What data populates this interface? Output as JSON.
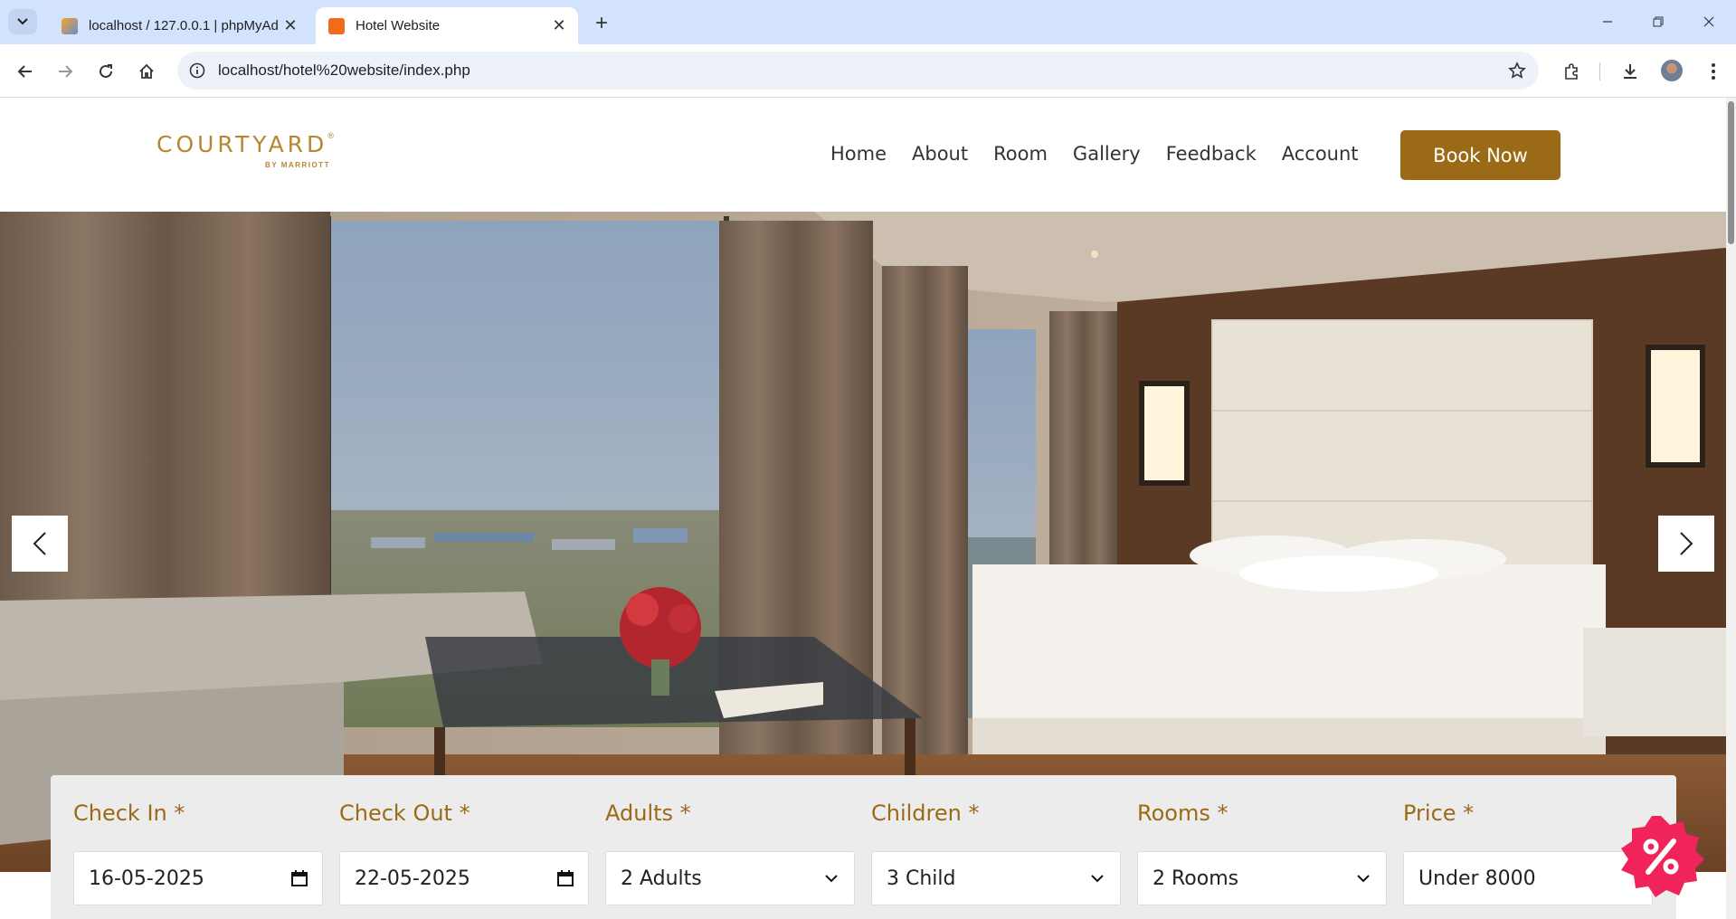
{
  "browser": {
    "tabs": [
      {
        "title": "localhost / 127.0.0.1 | phpMyAd",
        "favicon": "phpmyadmin-icon",
        "active": false
      },
      {
        "title": "Hotel Website",
        "favicon": "xampp-icon",
        "active": true
      }
    ],
    "url": "localhost/hotel%20website/index.php"
  },
  "site": {
    "logo": {
      "main": "COURTYARD",
      "sub": "BY MARRIOTT",
      "mark": "®"
    },
    "nav": [
      "Home",
      "About",
      "Room",
      "Gallery",
      "Feedback",
      "Account"
    ],
    "cta": "Book Now",
    "brand_color": "#9b6a16"
  },
  "hero": {
    "prev_icon": "chevron-left-icon",
    "next_icon": "chevron-right-icon"
  },
  "booking": {
    "fields": [
      {
        "label": "Check In *",
        "value": "16-05-2025",
        "kind": "date",
        "icon": "calendar-icon"
      },
      {
        "label": "Check Out *",
        "value": "22-05-2025",
        "kind": "date",
        "icon": "calendar-icon"
      },
      {
        "label": "Adults *",
        "value": "2 Adults",
        "kind": "select",
        "icon": "chevron-down-icon"
      },
      {
        "label": "Children *",
        "value": "3 Child",
        "kind": "select",
        "icon": "chevron-down-icon"
      },
      {
        "label": "Rooms *",
        "value": "2 Rooms",
        "kind": "select",
        "icon": "chevron-down-icon"
      },
      {
        "label": "Price *",
        "value": "Under 8000",
        "kind": "select",
        "icon": "chevron-down-icon"
      }
    ]
  },
  "promo": {
    "icon": "discount-badge-icon",
    "color": "#f0245a"
  }
}
